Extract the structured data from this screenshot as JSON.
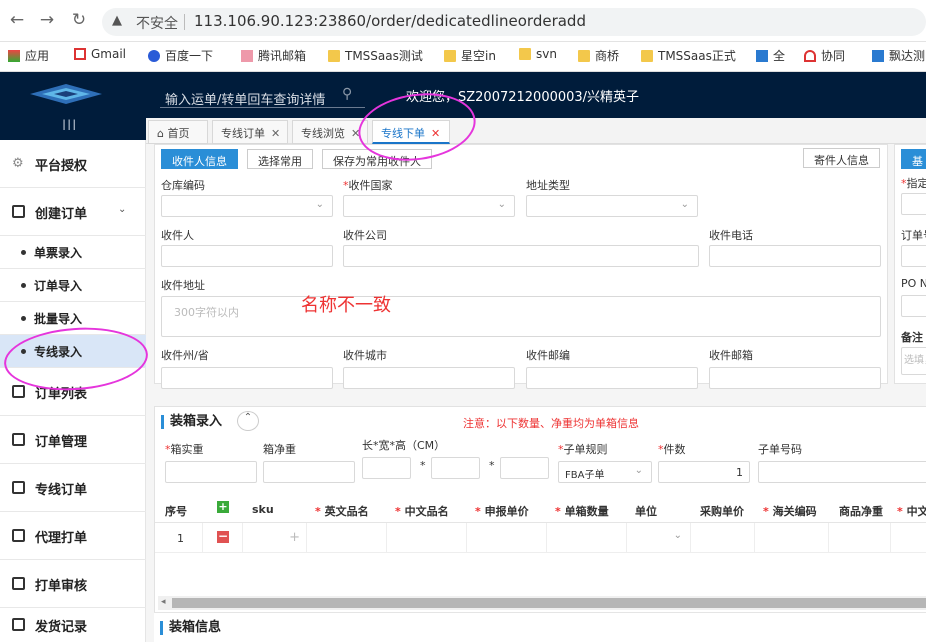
{
  "browser": {
    "security_label": "不安全",
    "url": "113.106.90.123:23860/order/dedicatedlineorderadd",
    "bookmarks": [
      "应用",
      "Gmail",
      "百度一下",
      "腾讯邮箱",
      "TMSSaas测试",
      "星空in",
      "svn",
      "商桥",
      "TMSSaas正式",
      "全",
      "协同",
      "飘达测"
    ]
  },
  "header": {
    "search_placeholder": "输入运单/转单回车查询详情",
    "welcome": "欢迎您，SZ2007212000003/兴精英子",
    "menu_toggle": "III"
  },
  "sidebar": {
    "items": [
      {
        "label": "平台授权",
        "icon": "gear-icon"
      },
      {
        "label": "创建订单",
        "icon": "box-icon"
      },
      {
        "label": "单票录入"
      },
      {
        "label": "订单导入"
      },
      {
        "label": "批量导入"
      },
      {
        "label": "专线录入"
      },
      {
        "label": "订单列表",
        "icon": "list-icon"
      },
      {
        "label": "订单管理",
        "icon": "list-icon"
      },
      {
        "label": "专线订单",
        "icon": "list-icon"
      },
      {
        "label": "代理打单",
        "icon": "printer-icon"
      },
      {
        "label": "打单审核",
        "icon": "printer-icon"
      },
      {
        "label": "发货记录",
        "icon": "printer-icon"
      }
    ]
  },
  "tabs": [
    {
      "label": "首页"
    },
    {
      "label": "专线订单",
      "close": "✕"
    },
    {
      "label": "专线浏览",
      "close": "✕"
    },
    {
      "label": "专线下单",
      "close": "✕"
    }
  ],
  "receiver": {
    "tab_active": "收件人信息",
    "tab_common": "选择常用",
    "tab_save": "保存为常用收件人",
    "sender_btn": "寄件人信息",
    "warehouse_code": "仓库编码",
    "country": "收件国家",
    "address_type": "地址类型",
    "name": "收件人",
    "company": "收件公司",
    "phone": "收件电话",
    "address": "收件地址",
    "address_placeholder": "300字符以内",
    "state": "收件州/省",
    "city": "收件城市",
    "zip": "收件邮编",
    "email": "收件邮箱",
    "annotation": "名称不一致"
  },
  "right_panel": {
    "btn": "基",
    "specify": "指定",
    "order_no": "订单号",
    "po": "PO N",
    "remark": "备注",
    "remark_placeholder": "选填，"
  },
  "packing": {
    "title": "装箱录入",
    "notice": "注意：以下数量、净重均为单箱信息",
    "box_weight": "箱实重",
    "box_net": "箱净重",
    "dims": "长*宽*高（CM）",
    "sub_rule": "子单规则",
    "pieces": "件数",
    "sub_no": "子单号码",
    "sub_rule_value": "FBA子单",
    "pieces_value": "1",
    "star": "*"
  },
  "table": {
    "headers": [
      "序号",
      "sku",
      "英文品名",
      "中文品名",
      "申报单价",
      "单箱数量",
      "单位",
      "采购单价",
      "海关编码",
      "商品净重",
      "中文"
    ],
    "required": [
      false,
      false,
      true,
      true,
      true,
      true,
      false,
      false,
      true,
      false,
      true
    ],
    "rows": [
      {
        "index": "1"
      }
    ]
  },
  "box_info": {
    "title": "装箱信息"
  }
}
